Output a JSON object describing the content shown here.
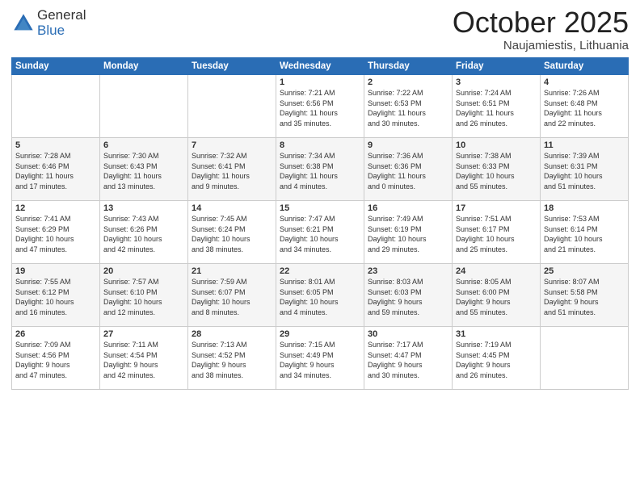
{
  "header": {
    "logo_general": "General",
    "logo_blue": "Blue",
    "month_title": "October 2025",
    "location": "Naujamiestis, Lithuania"
  },
  "days_of_week": [
    "Sunday",
    "Monday",
    "Tuesday",
    "Wednesday",
    "Thursday",
    "Friday",
    "Saturday"
  ],
  "weeks": [
    [
      {
        "day": "",
        "info": ""
      },
      {
        "day": "",
        "info": ""
      },
      {
        "day": "",
        "info": ""
      },
      {
        "day": "1",
        "info": "Sunrise: 7:21 AM\nSunset: 6:56 PM\nDaylight: 11 hours\nand 35 minutes."
      },
      {
        "day": "2",
        "info": "Sunrise: 7:22 AM\nSunset: 6:53 PM\nDaylight: 11 hours\nand 30 minutes."
      },
      {
        "day": "3",
        "info": "Sunrise: 7:24 AM\nSunset: 6:51 PM\nDaylight: 11 hours\nand 26 minutes."
      },
      {
        "day": "4",
        "info": "Sunrise: 7:26 AM\nSunset: 6:48 PM\nDaylight: 11 hours\nand 22 minutes."
      }
    ],
    [
      {
        "day": "5",
        "info": "Sunrise: 7:28 AM\nSunset: 6:46 PM\nDaylight: 11 hours\nand 17 minutes."
      },
      {
        "day": "6",
        "info": "Sunrise: 7:30 AM\nSunset: 6:43 PM\nDaylight: 11 hours\nand 13 minutes."
      },
      {
        "day": "7",
        "info": "Sunrise: 7:32 AM\nSunset: 6:41 PM\nDaylight: 11 hours\nand 9 minutes."
      },
      {
        "day": "8",
        "info": "Sunrise: 7:34 AM\nSunset: 6:38 PM\nDaylight: 11 hours\nand 4 minutes."
      },
      {
        "day": "9",
        "info": "Sunrise: 7:36 AM\nSunset: 6:36 PM\nDaylight: 11 hours\nand 0 minutes."
      },
      {
        "day": "10",
        "info": "Sunrise: 7:38 AM\nSunset: 6:33 PM\nDaylight: 10 hours\nand 55 minutes."
      },
      {
        "day": "11",
        "info": "Sunrise: 7:39 AM\nSunset: 6:31 PM\nDaylight: 10 hours\nand 51 minutes."
      }
    ],
    [
      {
        "day": "12",
        "info": "Sunrise: 7:41 AM\nSunset: 6:29 PM\nDaylight: 10 hours\nand 47 minutes."
      },
      {
        "day": "13",
        "info": "Sunrise: 7:43 AM\nSunset: 6:26 PM\nDaylight: 10 hours\nand 42 minutes."
      },
      {
        "day": "14",
        "info": "Sunrise: 7:45 AM\nSunset: 6:24 PM\nDaylight: 10 hours\nand 38 minutes."
      },
      {
        "day": "15",
        "info": "Sunrise: 7:47 AM\nSunset: 6:21 PM\nDaylight: 10 hours\nand 34 minutes."
      },
      {
        "day": "16",
        "info": "Sunrise: 7:49 AM\nSunset: 6:19 PM\nDaylight: 10 hours\nand 29 minutes."
      },
      {
        "day": "17",
        "info": "Sunrise: 7:51 AM\nSunset: 6:17 PM\nDaylight: 10 hours\nand 25 minutes."
      },
      {
        "day": "18",
        "info": "Sunrise: 7:53 AM\nSunset: 6:14 PM\nDaylight: 10 hours\nand 21 minutes."
      }
    ],
    [
      {
        "day": "19",
        "info": "Sunrise: 7:55 AM\nSunset: 6:12 PM\nDaylight: 10 hours\nand 16 minutes."
      },
      {
        "day": "20",
        "info": "Sunrise: 7:57 AM\nSunset: 6:10 PM\nDaylight: 10 hours\nand 12 minutes."
      },
      {
        "day": "21",
        "info": "Sunrise: 7:59 AM\nSunset: 6:07 PM\nDaylight: 10 hours\nand 8 minutes."
      },
      {
        "day": "22",
        "info": "Sunrise: 8:01 AM\nSunset: 6:05 PM\nDaylight: 10 hours\nand 4 minutes."
      },
      {
        "day": "23",
        "info": "Sunrise: 8:03 AM\nSunset: 6:03 PM\nDaylight: 9 hours\nand 59 minutes."
      },
      {
        "day": "24",
        "info": "Sunrise: 8:05 AM\nSunset: 6:00 PM\nDaylight: 9 hours\nand 55 minutes."
      },
      {
        "day": "25",
        "info": "Sunrise: 8:07 AM\nSunset: 5:58 PM\nDaylight: 9 hours\nand 51 minutes."
      }
    ],
    [
      {
        "day": "26",
        "info": "Sunrise: 7:09 AM\nSunset: 4:56 PM\nDaylight: 9 hours\nand 47 minutes."
      },
      {
        "day": "27",
        "info": "Sunrise: 7:11 AM\nSunset: 4:54 PM\nDaylight: 9 hours\nand 42 minutes."
      },
      {
        "day": "28",
        "info": "Sunrise: 7:13 AM\nSunset: 4:52 PM\nDaylight: 9 hours\nand 38 minutes."
      },
      {
        "day": "29",
        "info": "Sunrise: 7:15 AM\nSunset: 4:49 PM\nDaylight: 9 hours\nand 34 minutes."
      },
      {
        "day": "30",
        "info": "Sunrise: 7:17 AM\nSunset: 4:47 PM\nDaylight: 9 hours\nand 30 minutes."
      },
      {
        "day": "31",
        "info": "Sunrise: 7:19 AM\nSunset: 4:45 PM\nDaylight: 9 hours\nand 26 minutes."
      },
      {
        "day": "",
        "info": ""
      }
    ]
  ]
}
